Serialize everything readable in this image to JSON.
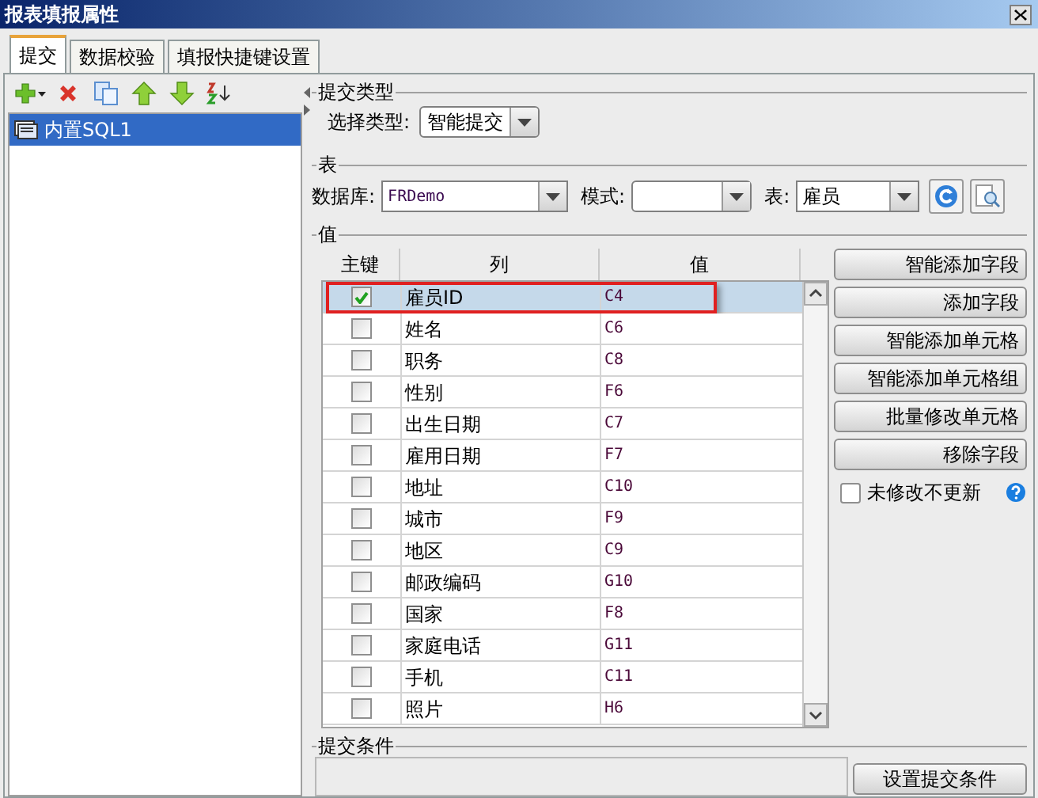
{
  "window": {
    "title": "报表填报属性"
  },
  "tabs": [
    {
      "label": "提交",
      "selected": true
    },
    {
      "label": "数据校验",
      "selected": false
    },
    {
      "label": "填报快捷键设置",
      "selected": false
    }
  ],
  "sidebar": {
    "items": [
      {
        "label": "内置SQL1",
        "selected": true
      }
    ]
  },
  "submit_type": {
    "legend": "提交类型",
    "label": "选择类型:",
    "value": "智能提交"
  },
  "table_source": {
    "legend": "表",
    "database_label": "数据库:",
    "database": "FRDemo",
    "schema_label": "模式:",
    "table_label": "表:",
    "table": "雇员"
  },
  "values": {
    "legend": "值",
    "columns": [
      "主键",
      "列",
      "值"
    ],
    "rows": [
      {
        "key": true,
        "column": "雇员ID",
        "value": "C4",
        "selected": true,
        "annotated": true
      },
      {
        "key": false,
        "column": "姓名",
        "value": "C6",
        "selected": false,
        "annotated": false
      },
      {
        "key": false,
        "column": "职务",
        "value": "C8",
        "selected": false,
        "annotated": false
      },
      {
        "key": false,
        "column": "性别",
        "value": "F6",
        "selected": false,
        "annotated": false
      },
      {
        "key": false,
        "column": "出生日期",
        "value": "C7",
        "selected": false,
        "annotated": false
      },
      {
        "key": false,
        "column": "雇用日期",
        "value": "F7",
        "selected": false,
        "annotated": false
      },
      {
        "key": false,
        "column": "地址",
        "value": "C10",
        "selected": false,
        "annotated": false
      },
      {
        "key": false,
        "column": "城市",
        "value": "F9",
        "selected": false,
        "annotated": false
      },
      {
        "key": false,
        "column": "地区",
        "value": "C9",
        "selected": false,
        "annotated": false
      },
      {
        "key": false,
        "column": "邮政编码",
        "value": "G10",
        "selected": false,
        "annotated": false
      },
      {
        "key": false,
        "column": "国家",
        "value": "F8",
        "selected": false,
        "annotated": false
      },
      {
        "key": false,
        "column": "家庭电话",
        "value": "G11",
        "selected": false,
        "annotated": false
      },
      {
        "key": false,
        "column": "手机",
        "value": "C11",
        "selected": false,
        "annotated": false
      },
      {
        "key": false,
        "column": "照片",
        "value": "H6",
        "selected": false,
        "annotated": false
      }
    ],
    "buttons": [
      "智能添加字段",
      "添加字段",
      "智能添加单元格",
      "智能添加单元格组",
      "批量修改单元格",
      "移除字段"
    ],
    "option": {
      "label": "未修改不更新",
      "checked": false
    }
  },
  "condition": {
    "legend": "提交条件",
    "button": "设置提交条件"
  }
}
